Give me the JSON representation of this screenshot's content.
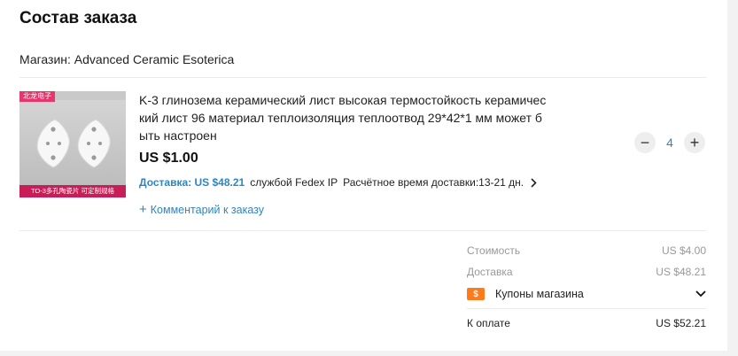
{
  "page_title": "Состав заказа",
  "store": {
    "label": "Магазин: Advanced Ceramic Esoterica"
  },
  "product": {
    "image_tag": "北龙电子",
    "image_caption": "TO-3多孔陶瓷片  可定制规格",
    "title": "K-3 глинозема керамический лист высокая термостойкость керамический лист 96 материал теплоизоляция теплоотвод 29*42*1 мм может быть настроен",
    "price": "US $1.00",
    "delivery_cost": "Доставка: US $48.21",
    "delivery_service": "службой Fedex IP",
    "delivery_time": "Расчётное время доставки:13-21 дн.",
    "comment_label": "Комментарий к заказу",
    "quantity": "4",
    "minus_symbol": "−",
    "plus_symbol": "+"
  },
  "summary": {
    "cost_label": "Стоимость",
    "cost_value": "US $4.00",
    "shipping_label": "Доставка",
    "shipping_value": "US $48.21",
    "coupon_badge": "$",
    "coupon_label": "Купоны магазина",
    "total_label": "К оплате",
    "total_value": "US $52.21"
  },
  "colors": {
    "accent_blue": "#2e86c1",
    "coupon_orange": "#ff7a1a",
    "thumb_tag_pink": "#e8356d"
  },
  "icons": {
    "delivery_chevron": "chevron-right-icon",
    "coupon_toggle": "chevron-down-icon",
    "comment_add": "plus-icon"
  }
}
